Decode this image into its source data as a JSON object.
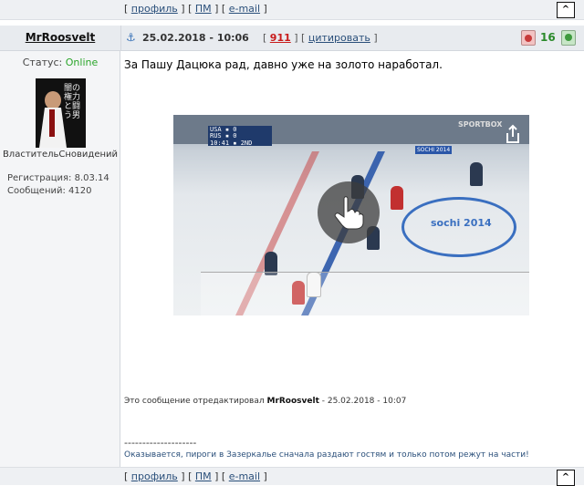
{
  "nav_links": {
    "prefix": "[",
    "profile": "профиль",
    "pm": "ПМ",
    "email": "e-mail",
    "sep": "] [",
    "suffix": "]",
    "up_label": "^"
  },
  "post": {
    "author": "MrRoosvelt",
    "date": "25.02.2018 - 10:06",
    "number": "911",
    "cite_label": "цитировать",
    "rating": "16",
    "status_label": "Статус:",
    "status_value": "Online",
    "user_title": "ВластительСновидений",
    "registration": "Регистрация: 8.03.14",
    "messages": "Сообщений: 4120",
    "text": "За Пашу Дацюка рад, давно уже на золото наработал.",
    "edited_prefix": "Это сообщение отредактировал",
    "edited_by": "MrRoosvelt",
    "edited_suffix": "- 25.02.2018 - 10:07",
    "signature_line": "--------------------",
    "signature": "Оказывается, пироги в Зазеркалье сначала раздают гостям и только потом режут на части!"
  },
  "video": {
    "score_usa": "USA ▪ 0",
    "score_rus": "RUS ▪ 0",
    "clock": "10:41 ▪ 2ND",
    "sponsor": "SPORTBOX",
    "games": "SOCHI 2014",
    "center": "sochi 2014"
  },
  "colors": {
    "accent": "#2a4f7a",
    "online": "#2aa52a",
    "post_number": "#c81b1b",
    "rating": "#2b8a2b"
  },
  "avatar": {
    "jp_text": "闇の権力と闘う男"
  }
}
